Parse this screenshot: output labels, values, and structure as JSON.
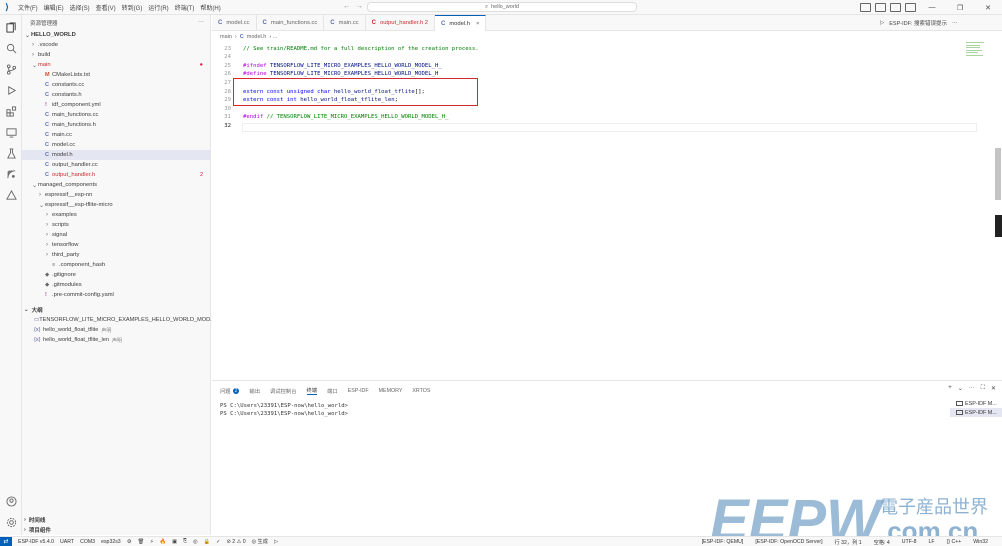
{
  "window": {
    "menu": [
      "文件(F)",
      "编辑(E)",
      "选择(S)",
      "查看(V)",
      "转到(G)",
      "运行(R)",
      "终端(T)",
      "帮助(H)"
    ],
    "search_text": "hello_world",
    "nav_back": "←",
    "nav_forward": "→",
    "window_controls": [
      "—",
      "❐",
      "✕"
    ]
  },
  "sidebar": {
    "title": "资源管理器",
    "more": "···",
    "root": "HELLO_WORLD",
    "items": [
      {
        "label": ".vscode",
        "indent": 1,
        "chevron": "›",
        "icon": "",
        "color": "",
        "badge": ""
      },
      {
        "label": "build",
        "indent": 1,
        "chevron": "›",
        "icon": "",
        "color": "",
        "badge": ""
      },
      {
        "label": "main",
        "indent": 1,
        "chevron": "⌄",
        "icon": "",
        "color": "red",
        "badge": "●"
      },
      {
        "label": "CMakeLists.txt",
        "indent": 2,
        "chevron": "",
        "icon": "M",
        "color": "",
        "badge": ""
      },
      {
        "label": "constants.cc",
        "indent": 2,
        "chevron": "",
        "icon": "C",
        "color": "",
        "badge": ""
      },
      {
        "label": "constants.h",
        "indent": 2,
        "chevron": "",
        "icon": "C",
        "color": "",
        "badge": ""
      },
      {
        "label": "idf_component.yml",
        "indent": 2,
        "chevron": "",
        "icon": "!",
        "color": "",
        "badge": ""
      },
      {
        "label": "main_functions.cc",
        "indent": 2,
        "chevron": "",
        "icon": "C",
        "color": "",
        "badge": ""
      },
      {
        "label": "main_functions.h",
        "indent": 2,
        "chevron": "",
        "icon": "C",
        "color": "",
        "badge": ""
      },
      {
        "label": "main.cc",
        "indent": 2,
        "chevron": "",
        "icon": "C",
        "color": "",
        "badge": ""
      },
      {
        "label": "model.cc",
        "indent": 2,
        "chevron": "",
        "icon": "C",
        "color": "",
        "badge": ""
      },
      {
        "label": "model.h",
        "indent": 2,
        "chevron": "",
        "icon": "C",
        "color": "",
        "badge": "",
        "selected": true
      },
      {
        "label": "output_handler.cc",
        "indent": 2,
        "chevron": "",
        "icon": "C",
        "color": "",
        "badge": ""
      },
      {
        "label": "output_handler.h",
        "indent": 2,
        "chevron": "",
        "icon": "C",
        "color": "red",
        "badge": "2"
      },
      {
        "label": "managed_components",
        "indent": 1,
        "chevron": "⌄",
        "icon": "",
        "color": "",
        "badge": ""
      },
      {
        "label": "espressif__esp-nn",
        "indent": 2,
        "chevron": "›",
        "icon": "",
        "color": "",
        "badge": ""
      },
      {
        "label": "espressif__esp-tflite-micro",
        "indent": 2,
        "chevron": "⌄",
        "icon": "",
        "color": "",
        "badge": ""
      },
      {
        "label": "examples",
        "indent": 3,
        "chevron": "›",
        "icon": "",
        "color": "",
        "badge": ""
      },
      {
        "label": "scripts",
        "indent": 3,
        "chevron": "›",
        "icon": "",
        "color": "",
        "badge": ""
      },
      {
        "label": "signal",
        "indent": 3,
        "chevron": "›",
        "icon": "",
        "color": "",
        "badge": ""
      },
      {
        "label": "tensorflow",
        "indent": 3,
        "chevron": "›",
        "icon": "",
        "color": "",
        "badge": ""
      },
      {
        "label": "third_party",
        "indent": 3,
        "chevron": "›",
        "icon": "",
        "color": "",
        "badge": ""
      },
      {
        "label": ".component_hash",
        "indent": 3,
        "chevron": "",
        "icon": "≡",
        "color": "",
        "badge": ""
      },
      {
        "label": ".gitignore",
        "indent": 2,
        "chevron": "",
        "icon": "◆",
        "color": "",
        "badge": ""
      },
      {
        "label": ".gitmodules",
        "indent": 2,
        "chevron": "",
        "icon": "◆",
        "color": "",
        "badge": ""
      },
      {
        "label": ".pre-commit-config.yaml",
        "indent": 2,
        "chevron": "",
        "icon": "!",
        "color": "",
        "badge": ""
      }
    ],
    "outline_title": "大纲",
    "outline": [
      {
        "label": "TENSORFLOW_LITE_MICRO_EXAMPLES_HELLO_WORLD_MOD...",
        "icon": "▭",
        "tag": ""
      },
      {
        "label": "hello_world_float_tflite",
        "icon": "{x}",
        "tag": "声明"
      },
      {
        "label": "hello_world_float_tflite_len",
        "icon": "{x}",
        "tag": "声明"
      }
    ],
    "timeline_title": "时间线",
    "project_title": "项目组件"
  },
  "tabs": [
    {
      "label": "model.cc",
      "active": false,
      "color": ""
    },
    {
      "label": "main_functions.cc",
      "active": false,
      "color": ""
    },
    {
      "label": "main.cc",
      "active": false,
      "color": ""
    },
    {
      "label": "output_handler.h 2",
      "active": false,
      "color": "red"
    },
    {
      "label": "model.h",
      "active": true,
      "color": ""
    }
  ],
  "tabs_right": {
    "run": "▷",
    "esp_idf": "ESP-IDF: 搜索错误提示",
    "more": "···"
  },
  "breadcrumb": {
    "folder": "main",
    "sep": "›",
    "file": "model.h",
    "rest": "› ..."
  },
  "editor": {
    "lines": [
      {
        "n": "23",
        "segments": [
          {
            "c": "cm",
            "t": "// See train/README.md for a full description of the creation process."
          }
        ]
      },
      {
        "n": "24",
        "segments": []
      },
      {
        "n": "25",
        "segments": [
          {
            "c": "pp",
            "t": "#ifndef "
          },
          {
            "c": "id",
            "t": "TENSORFLOW_LITE_MICRO_EXAMPLES_HELLO_WORLD_MODEL_H_"
          }
        ]
      },
      {
        "n": "26",
        "segments": [
          {
            "c": "pp",
            "t": "#define "
          },
          {
            "c": "id",
            "t": "TENSORFLOW_LITE_MICRO_EXAMPLES_HELLO_WORLD_MODEL_H"
          }
        ]
      },
      {
        "n": "27",
        "segments": []
      },
      {
        "n": "28",
        "segments": [
          {
            "c": "kw",
            "t": "extern const unsigned char "
          },
          {
            "c": "id",
            "t": "hello_world_float_tflite"
          },
          {
            "c": "plain",
            "t": "[];"
          }
        ]
      },
      {
        "n": "29",
        "segments": [
          {
            "c": "kw",
            "t": "extern const int "
          },
          {
            "c": "id",
            "t": "hello_world_float_tflite_len"
          },
          {
            "c": "plain",
            "t": ";"
          }
        ]
      },
      {
        "n": "30",
        "segments": []
      },
      {
        "n": "31",
        "segments": [
          {
            "c": "pp",
            "t": "#endif "
          },
          {
            "c": "cm",
            "t": "// TENSORFLOW_LITE_MICRO_EXAMPLES_HELLO_WORLD_MODEL_H_"
          }
        ]
      },
      {
        "n": "32",
        "segments": [],
        "current": true
      }
    ]
  },
  "panel": {
    "tabs": [
      {
        "label": "问题",
        "badge": "2",
        "active": false
      },
      {
        "label": "输出",
        "badge": "",
        "active": false
      },
      {
        "label": "调试控制台",
        "badge": "",
        "active": false
      },
      {
        "label": "终端",
        "badge": "",
        "active": true
      },
      {
        "label": "端口",
        "badge": "",
        "active": false
      },
      {
        "label": "ESP-IDF",
        "badge": "",
        "active": false
      },
      {
        "label": "MEMORY",
        "badge": "",
        "active": false
      },
      {
        "label": "XRTOS",
        "badge": "",
        "active": false
      }
    ],
    "right_controls": [
      "+",
      "⌄",
      "···",
      "⛶",
      "✕"
    ],
    "terminal_lines": [
      "PS C:\\Users\\23391\\ESP-now\\hello_world>",
      "PS C:\\Users\\23391\\ESP-now\\hello_world>"
    ],
    "terminal_list": [
      "ESP-IDF M...",
      "ESP-IDF M..."
    ]
  },
  "statusbar": {
    "remote": "⇄",
    "left": [
      "ESP-IDF v5.4.0",
      "UART",
      "COM3",
      "esp32s3",
      "⚙",
      "🗑",
      "⚡",
      "🔥",
      "▣",
      "⎘",
      "◎",
      "🔒",
      "✓",
      "⊘ 2 ⚠ 0",
      "◎ 生成",
      "▷"
    ],
    "right": [
      "[ESP-IDF: QEMU]",
      "[ESP-IDF: OpenOCD Server]",
      "行 32，列 1",
      "空格: 4",
      "UTF-8",
      "LF",
      "{} C++",
      "Win32"
    ]
  },
  "watermark": {
    "brand": "EEPW",
    "cn": "電子産品世界",
    "domain": ".com.cn"
  },
  "colors": {
    "accent": "#005fb8",
    "highlight_box": "#d62828",
    "watermark": "#7aa4c9"
  }
}
